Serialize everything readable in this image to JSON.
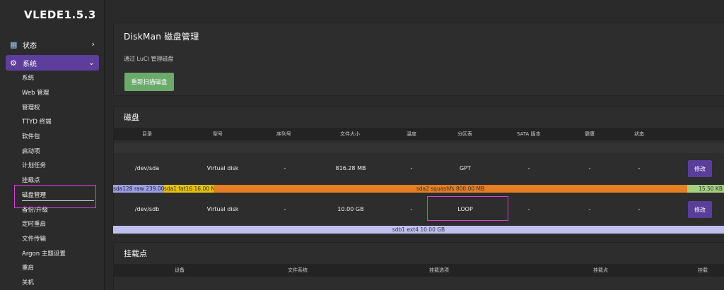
{
  "brand": "VLEDE1.5.3",
  "nav": {
    "status": "状态",
    "system": "系统",
    "submenu": [
      "系统",
      "Web 管理",
      "管理权",
      "TTYD 终端",
      "软件包",
      "启动项",
      "计划任务",
      "挂载点",
      "磁盘管理",
      "备份/升级",
      "定时重启",
      "文件传输",
      "Argon 主题设置",
      "重启",
      "关机"
    ]
  },
  "diskman": {
    "title": "DiskMan 磁盘管理",
    "description": "通过 LuCI 管理磁盘",
    "rescan_label": "重新扫描磁盘"
  },
  "disks": {
    "title": "磁盘",
    "headers": [
      "目录",
      "型号",
      "序列号",
      "文件大小",
      "温度",
      "分区表",
      "SATA 版本",
      "健康",
      "状态"
    ],
    "rows": [
      {
        "path": "/dev/sda",
        "model": "Virtual disk",
        "serial": "-",
        "size": "816.28 MB",
        "temp": "-",
        "table": "GPT",
        "sata": "-",
        "health": "-",
        "status": "-",
        "edit": "修改"
      },
      {
        "path": "/dev/sdb",
        "model": "Virtual disk",
        "serial": "-",
        "size": "10.00 GB",
        "temp": "-",
        "table": "LOOP",
        "sata": "-",
        "health": "-",
        "status": "-",
        "edit": "修改"
      }
    ],
    "sda_partitions": [
      "sda128 raw 239.00",
      "sda1 fat16 16.00 M",
      "sda2 squashfs 800.00 MB",
      "15.50 KB"
    ],
    "sdb_partitions": [
      "sdb1 ext4 10.00 GB"
    ]
  },
  "mounts": {
    "title": "挂载点",
    "headers": [
      "设备",
      "文件系统",
      "挂载选项",
      "挂载点",
      "挂载"
    ]
  },
  "colors": {
    "accent": "#5e3e9c",
    "rescan": "#6aaa6a",
    "highlight": "#d640d6",
    "part_raw": "#9f9fe6",
    "part_fat": "#e6c200",
    "part_squashfs": "#e67e22",
    "part_free": "#a4d080",
    "part_ext4": "#c0c0f0"
  }
}
